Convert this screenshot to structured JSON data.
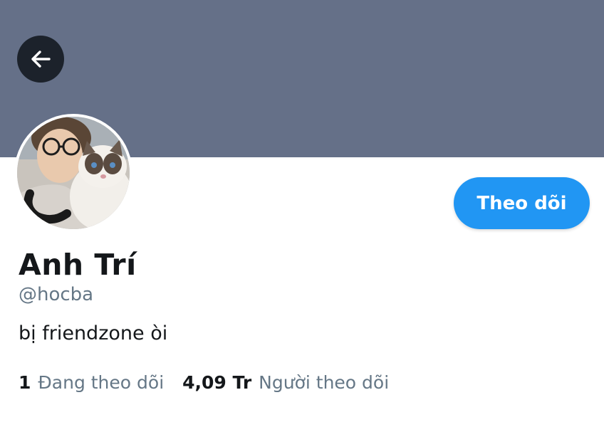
{
  "header": {
    "banner_color": "#657088",
    "back_icon": "arrow-left-icon"
  },
  "profile": {
    "avatar_icon": "profile-avatar-photo",
    "display_name": "Anh Trí",
    "handle": "@hocba",
    "bio": "bị friendzone òi",
    "follow_label": "Theo dõi",
    "accent_color": "#2196f3"
  },
  "stats": {
    "following_count": "1",
    "following_label": "Đang theo dõi",
    "followers_count": "4,09 Tr",
    "followers_label": "Người theo dõi"
  }
}
